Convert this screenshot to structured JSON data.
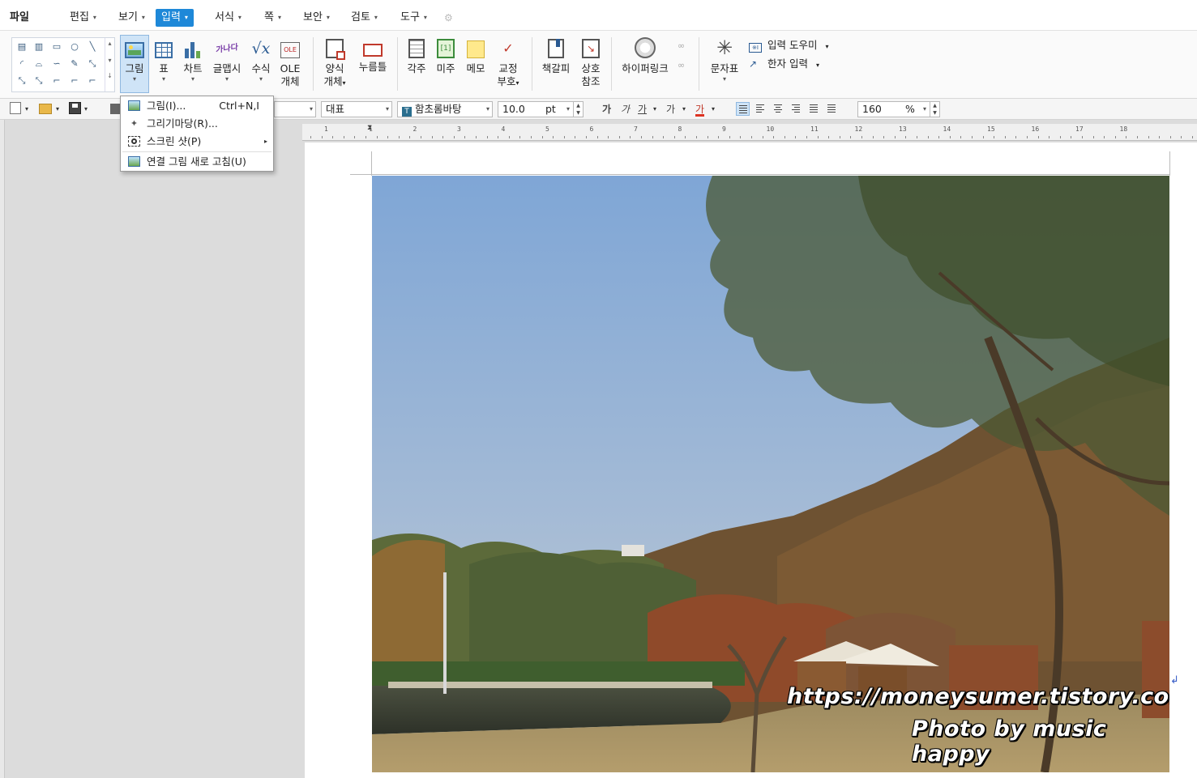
{
  "menubar": {
    "file": "파일",
    "items": [
      {
        "label": "편집",
        "arrow": "▾"
      },
      {
        "label": "보기",
        "arrow": "▾"
      },
      {
        "label": "입력",
        "arrow": "▾",
        "active": true
      },
      {
        "label": "서식",
        "arrow": "▾"
      },
      {
        "label": "쪽",
        "arrow": "▾"
      },
      {
        "label": "보안",
        "arrow": "▾"
      },
      {
        "label": "검토",
        "arrow": "▾"
      },
      {
        "label": "도구",
        "arrow": "▾"
      }
    ]
  },
  "ribbon": {
    "picture": "그림",
    "table": "표",
    "chart": "차트",
    "wordart": "글맵시",
    "equation": "수식",
    "ole_line1": "OLE",
    "ole_line2": "개체",
    "ole_icon_text": "OLE",
    "form_line1": "양식",
    "form_line2": "개체",
    "button": "누름틀",
    "footnote": "각주",
    "endnote": "미주",
    "memo": "메모",
    "proof_line1": "교정",
    "proof_line2": "부호",
    "bookmark": "책갈피",
    "crossref_line1": "상호",
    "crossref_line2": "참조",
    "hyperlink": "하이퍼링크",
    "charmap": "문자표",
    "input_helper": "입력 도우미",
    "hanja_input": "한자 입력",
    "wordart_icon_text": "가나다",
    "dropdown_arrow": "▾"
  },
  "format_bar": {
    "style": "대표",
    "font": "함초롬바탕",
    "size": "10.0",
    "unit": "pt",
    "bold": "가",
    "italic": "가",
    "underline": "가",
    "strike": "가",
    "color": "가",
    "zoom": "160",
    "zoom_unit": "%"
  },
  "dropdown_menu": {
    "items": [
      {
        "label": "그림(I)...",
        "shortcut": "Ctrl+N,I"
      },
      {
        "label": "그리기마당(R)...",
        "shortcut": ""
      },
      {
        "label": "스크린 샷(P)",
        "submenu_arrow": "▸"
      },
      {
        "label": "연결 그림 새로 고침(U)",
        "shortcut": ""
      }
    ]
  },
  "document": {
    "watermark_url": "https://moneysumer.tistory.com",
    "watermark_credit": "Photo by music happy",
    "paragraph_mark": "↲"
  },
  "ruler": {
    "labels": [
      "1",
      "1",
      "2",
      "3",
      "4",
      "5",
      "6",
      "7",
      "8",
      "9",
      "10",
      "11",
      "12",
      "13",
      "14",
      "15",
      "16",
      "17",
      "18"
    ]
  },
  "colors": {
    "accent": "#1e88d8",
    "selected_bg": "#cfe4f7",
    "sky_top": "#7fa6d6",
    "sky_bottom": "#b9c7cf",
    "foliage_autumn": "#8a5a2e",
    "grass": "#a99467"
  }
}
